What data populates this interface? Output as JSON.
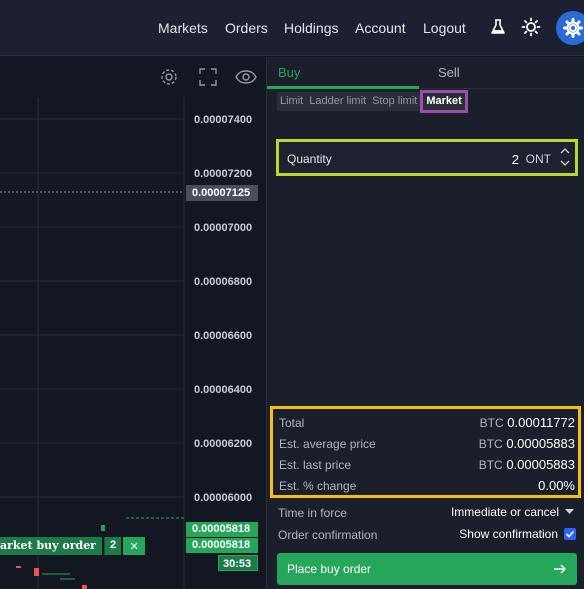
{
  "nav": {
    "markets": "Markets",
    "orders": "Orders",
    "holdings": "Holdings",
    "account": "Account",
    "logout": "Logout"
  },
  "chart": {
    "price_ticks": [
      "0.00007400",
      "0.00007200",
      "0.00007000",
      "0.00006800",
      "0.00006600",
      "0.00006400",
      "0.00006200",
      "0.00006000"
    ],
    "current_price": "0.00007125",
    "order_price_a": "0.00005818",
    "order_price_b": "0.00005818",
    "countdown": "30:53",
    "order_tag": {
      "label": "arket buy order",
      "qty": "2",
      "close": "✕"
    }
  },
  "panel": {
    "tabs": {
      "buy": "Buy",
      "sell": "Sell"
    },
    "order_types": [
      "Limit",
      "Ladder limit",
      "Stop limit",
      "Market"
    ],
    "selected_type": "Market",
    "quantity": {
      "label": "Quantity",
      "value": "2",
      "unit": "ONT"
    },
    "summary": [
      {
        "label": "Total",
        "currency": "BTC",
        "value": "0.00011772"
      },
      {
        "label": "Est. average price",
        "currency": "BTC",
        "value": "0.00005883"
      },
      {
        "label": "Est. last price",
        "currency": "BTC",
        "value": "0.00005883"
      },
      {
        "label": "Est. % change",
        "currency": "",
        "value": "0.00%"
      }
    ],
    "time_in_force": {
      "label": "Time in force",
      "value": "Immediate or cancel"
    },
    "order_confirmation": {
      "label": "Order confirmation",
      "value": "Show confirmation",
      "checked": true
    },
    "place_order": "Place buy order"
  },
  "colors": {
    "buy_green": "#26a65b",
    "highlight_market": "#9b4fa8",
    "highlight_quantity": "#b6d92e",
    "highlight_summary": "#f4c20d",
    "accent_blue": "#2b6bd6"
  }
}
